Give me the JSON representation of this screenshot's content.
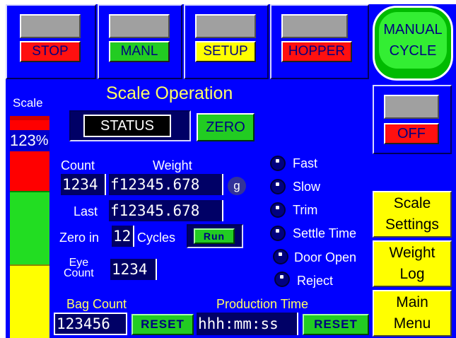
{
  "top_buttons": [
    {
      "id": "stop",
      "label": "STOP",
      "color": "#ff1010",
      "text_color": "#000080"
    },
    {
      "id": "manl",
      "label": "MANL",
      "color": "#22cc22",
      "text_color": "#000080"
    },
    {
      "id": "setup",
      "label": "SETUP",
      "color": "#ffff00",
      "text_color": "#000080"
    },
    {
      "id": "hopper",
      "label": "HOPPER",
      "color": "#ff1010",
      "text_color": "#000080"
    }
  ],
  "manual_cycle": {
    "line1": "MANUAL",
    "line2": "CYCLE"
  },
  "off_toggle": {
    "label": "OFF"
  },
  "title": "Scale Operation",
  "scale_bar": {
    "label": "Scale",
    "value": "123",
    "unit": "%"
  },
  "status_label": "STATUS",
  "zero_label": "ZERO",
  "count": {
    "label": "Count",
    "value": "1234"
  },
  "weight": {
    "label": "Weight",
    "value": "f12345.678",
    "unit": "g"
  },
  "last": {
    "label": "Last",
    "value": "f12345.678"
  },
  "zero_in": {
    "label": "Zero in",
    "value": "12",
    "suffix": "Cycles",
    "button": "Run"
  },
  "eye_count": {
    "label_line1": "Eye",
    "label_line2": "Count",
    "value": "1234"
  },
  "indicators": [
    "Fast",
    "Slow",
    "Trim",
    "Settle Time",
    "Door Open",
    "Reject"
  ],
  "bag_count": {
    "label": "Bag Count",
    "value": "123456",
    "reset": "RESET"
  },
  "production_time": {
    "label": "Production Time",
    "value": "hhh:mm:ss",
    "reset": "RESET"
  },
  "menu": {
    "scale_settings": {
      "line1": "Scale",
      "line2": "Settings"
    },
    "weight_log": {
      "line1": "Weight",
      "line2": "Log"
    },
    "main_menu": {
      "line1": "Main",
      "line2": "Menu"
    }
  }
}
